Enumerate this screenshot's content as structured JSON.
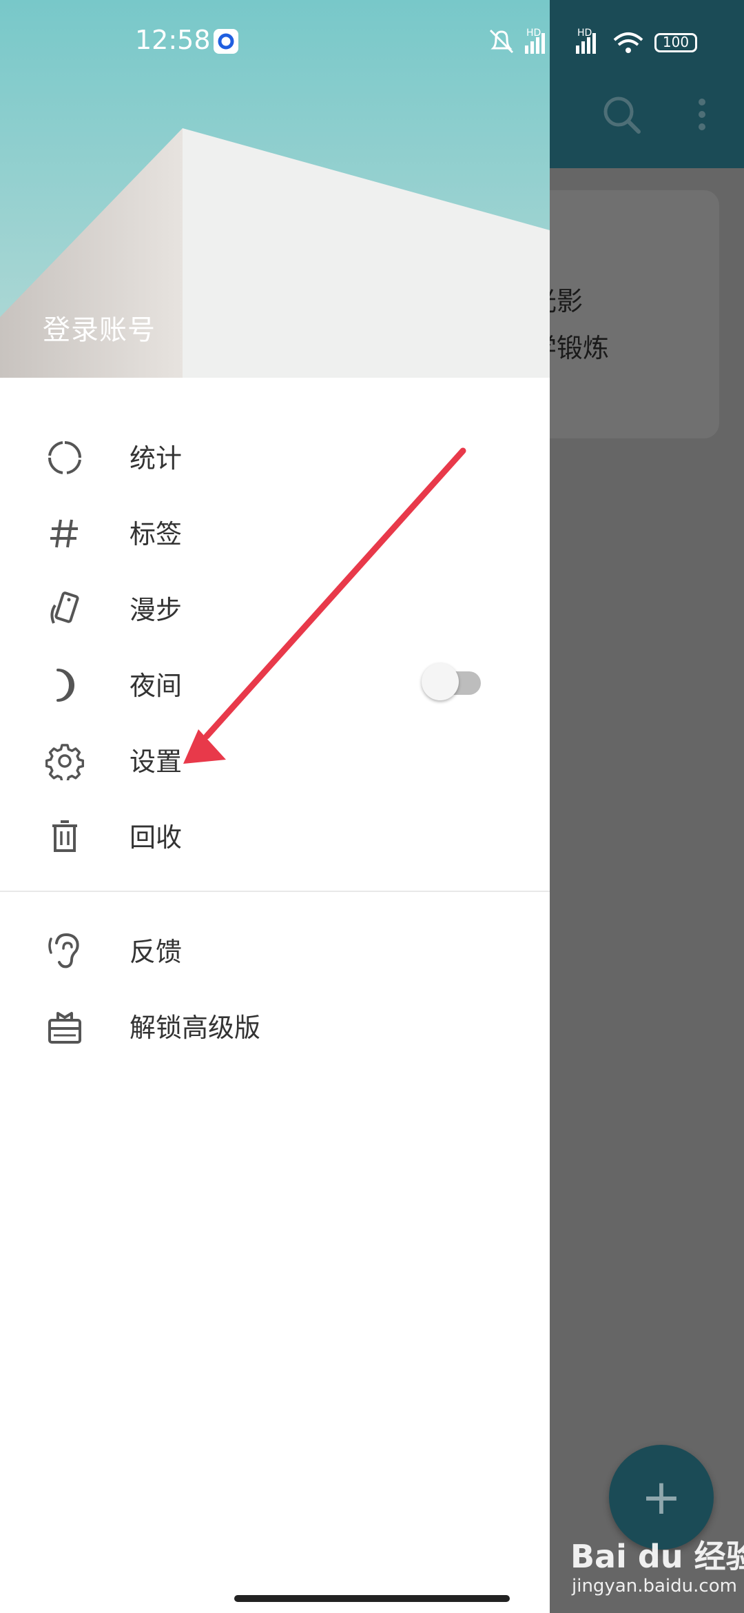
{
  "status_bar": {
    "time": "12:58",
    "battery": "100",
    "network_labels": [
      "HD",
      "HD"
    ]
  },
  "background_app": {
    "card_line1": "光影",
    "card_line2": "学锻炼",
    "fab_icon": "+",
    "toolbar_color": "#1b4b56"
  },
  "drawer": {
    "header_label": "登录账号",
    "menu_primary": [
      {
        "label": "统计",
        "icon": "stats-ring-icon"
      },
      {
        "label": "标签",
        "icon": "hashtag-icon"
      },
      {
        "label": "漫步",
        "icon": "wander-card-icon"
      },
      {
        "label": "夜间",
        "icon": "moon-icon"
      },
      {
        "label": "设置",
        "icon": "gear-icon"
      },
      {
        "label": "回收",
        "icon": "trash-icon"
      }
    ],
    "menu_secondary": [
      {
        "label": "反馈",
        "icon": "ear-icon"
      },
      {
        "label": "解锁高级版",
        "icon": "gift-icon"
      }
    ],
    "night_mode_enabled": false
  },
  "watermark": {
    "logo": "Bai du 经验",
    "url": "jingyan.baidu.com"
  },
  "colors": {
    "accent_arrow": "#e8394a",
    "header_sky": "#7fc9cb"
  }
}
